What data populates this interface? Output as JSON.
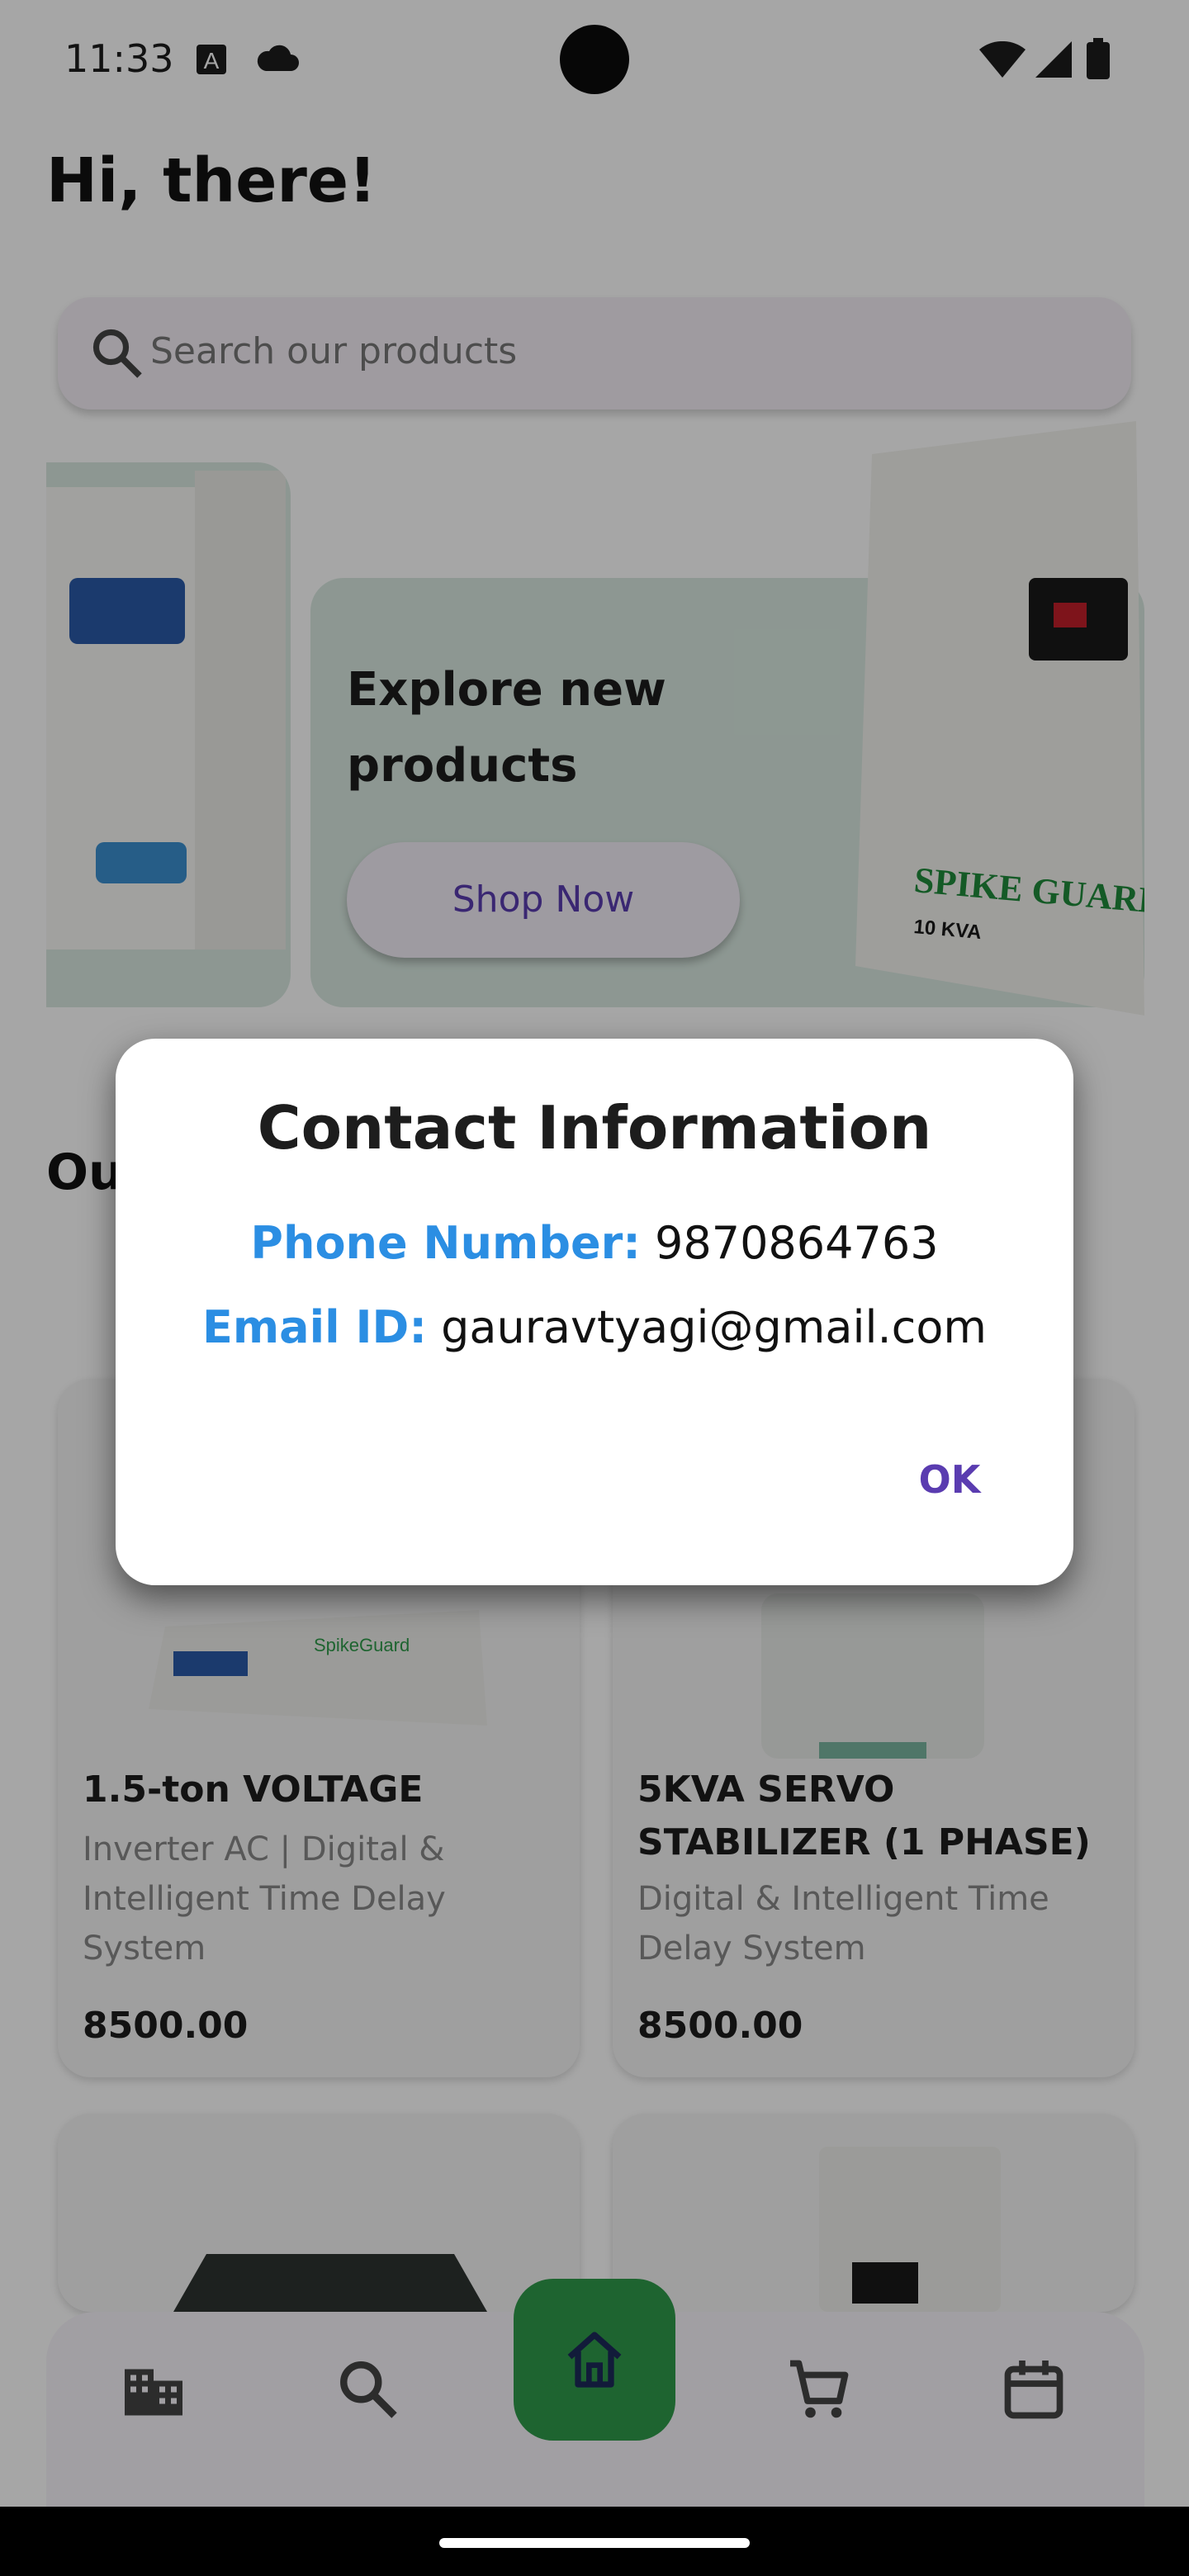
{
  "status_bar": {
    "time": "11:33"
  },
  "header": {
    "greeting": "Hi, there!"
  },
  "search": {
    "placeholder": "Search our products"
  },
  "banner": {
    "title": "Explore new products",
    "button_label": "Shop Now"
  },
  "section": {
    "title": "Ou"
  },
  "products": [
    {
      "title": "1.5-ton VOLTAGE",
      "description": "Inverter AC | Digital & Intelligent Time Delay System",
      "price": "8500.00"
    },
    {
      "title": "5KVA SERVO STABILIZER (1 PHASE)",
      "description": "Digital & Intelligent Time Delay System",
      "price": "8500.00"
    }
  ],
  "dialog": {
    "title": "Contact Information",
    "phone_label": "Phone Number:",
    "phone_value": "9870864763",
    "email_label": "Email ID:",
    "email_value": "gauravtyagi@gmail.com",
    "ok_label": "OK"
  },
  "colors": {
    "accent": "#2f9a4b",
    "link": "#2b8ee3",
    "primary": "#5a3cb0"
  }
}
